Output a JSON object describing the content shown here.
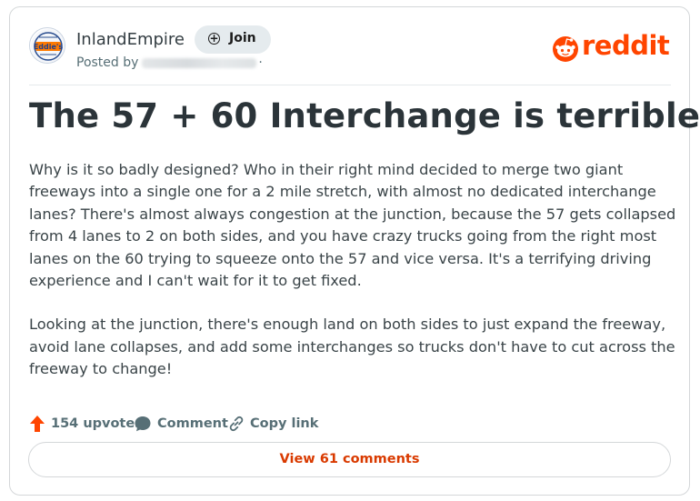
{
  "post": {
    "subreddit": "InlandEmpire",
    "join_label": "Join",
    "posted_by_prefix": "Posted by",
    "posted_by_suffix": "·",
    "title": "The 57 + 60 Interchange is terrible",
    "paragraphs": [
      "Why is it so badly designed? Who in their right mind decided to merge two giant freeways into a single one for a 2 mile stretch, with almost no dedicated interchange lanes? There's almost always congestion at the junction, because the 57 gets collapsed from 4 lanes to 2 on both sides, and you have crazy trucks going from the right most lanes on the 60 trying to squeeze onto the 57 and vice versa. It's a terrifying driving experience and I can't wait for it to get fixed.",
      "Looking at the junction, there's enough land on both sides to just expand the freeway, avoid lane collapses, and add some interchanges so trucks don't have to cut across the freeway to change!"
    ]
  },
  "brand": {
    "wordmark": "reddit",
    "color": "#ff4500"
  },
  "avatar": {
    "text": "Eddie's"
  },
  "actions": {
    "upvotes_label": "154 upvotes",
    "comment_label": "Comment",
    "copy_link_label": "Copy link"
  },
  "view_comments_label": "View 61 comments",
  "icons": [
    "upvote-arrow-icon",
    "comment-bubble-icon",
    "link-icon",
    "plus-circle-icon",
    "reddit-logo-icon"
  ],
  "colors": {
    "accent": "#ff4500",
    "link_text": "#d93a00",
    "muted": "#576f76",
    "title": "#2b3439"
  }
}
